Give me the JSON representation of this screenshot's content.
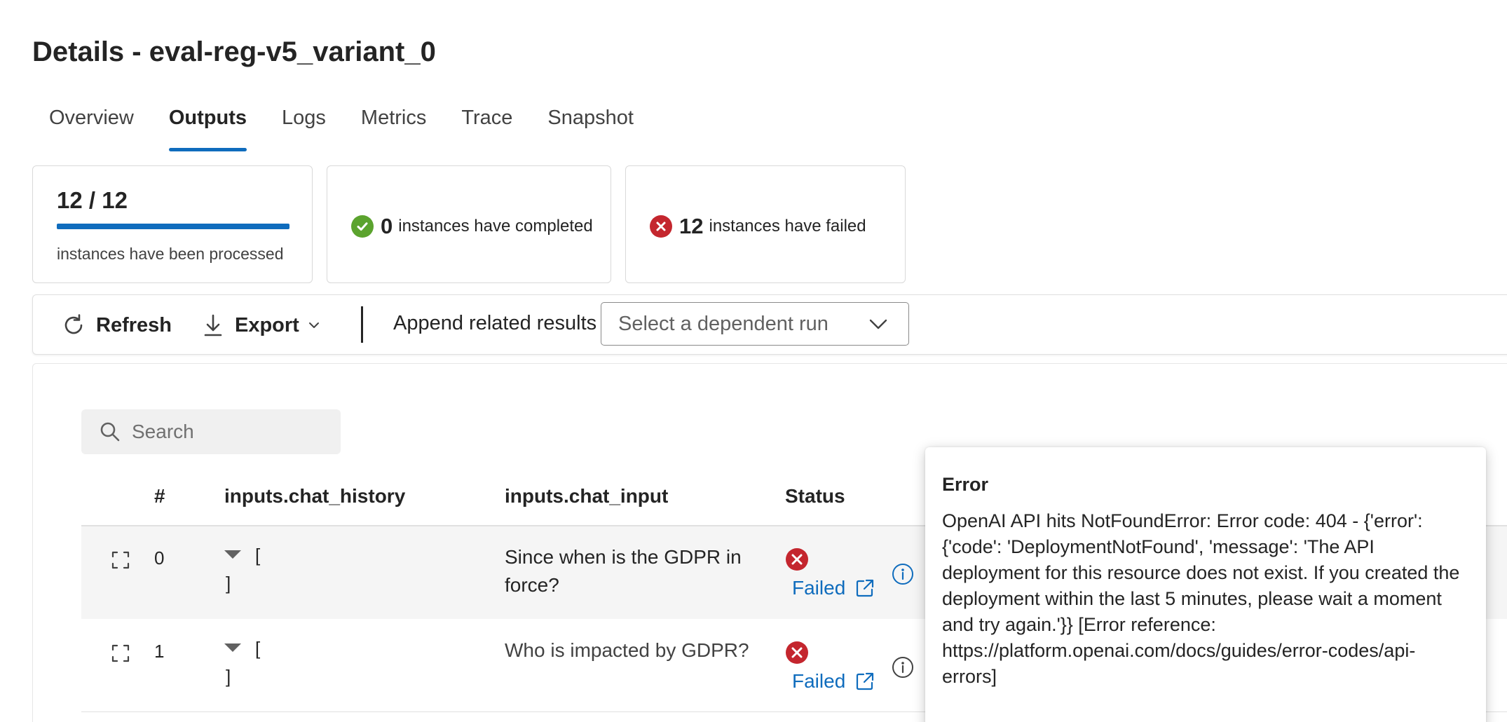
{
  "page": {
    "title": "Details - eval-reg-v5_variant_0"
  },
  "tabs": [
    {
      "label": "Overview",
      "active": false
    },
    {
      "label": "Outputs",
      "active": true
    },
    {
      "label": "Logs",
      "active": false
    },
    {
      "label": "Metrics",
      "active": false
    },
    {
      "label": "Trace",
      "active": false
    },
    {
      "label": "Snapshot",
      "active": false
    }
  ],
  "summary": {
    "processed": {
      "value": "12 / 12",
      "label": "instances have been processed",
      "progress": 1.0
    },
    "completed": {
      "count": "0",
      "label": "instances have completed"
    },
    "failed": {
      "count": "12",
      "label": "instances have failed"
    }
  },
  "toolbar": {
    "refresh_label": "Refresh",
    "export_label": "Export",
    "append_label": "Append related results",
    "dependent_run_placeholder": "Select a dependent run"
  },
  "search": {
    "placeholder": "Search"
  },
  "table": {
    "columns": [
      "#",
      "inputs.chat_history",
      "inputs.chat_input",
      "Status"
    ],
    "rows": [
      {
        "index": "0",
        "history_open": "[",
        "history_close": "]",
        "chat_input": "Since when is the GDPR in force?",
        "status": "Failed"
      },
      {
        "index": "1",
        "history_open": "[",
        "history_close": "]",
        "chat_input": "Who is impacted by GDPR?",
        "status": "Failed"
      }
    ]
  },
  "tooltip": {
    "title": "Error",
    "body": "OpenAI API hits NotFoundError: Error code: 404 - {'error': {'code': 'DeploymentNotFound', 'message': 'The API deployment for this resource does not exist. If you created the deployment within the last 5 minutes, please wait a moment and try again.'}} [Error reference: https://platform.openai.com/docs/guides/error-codes/api-errors]"
  },
  "colors": {
    "accent": "#0f6cbd",
    "success": "#5ba32e",
    "error": "#c4262e"
  },
  "icons": [
    "refresh-icon",
    "download-icon",
    "chevron-down-icon",
    "search-icon",
    "expand-icon",
    "caret-down-icon",
    "error-icon",
    "success-icon",
    "open-external-icon",
    "info-icon"
  ]
}
